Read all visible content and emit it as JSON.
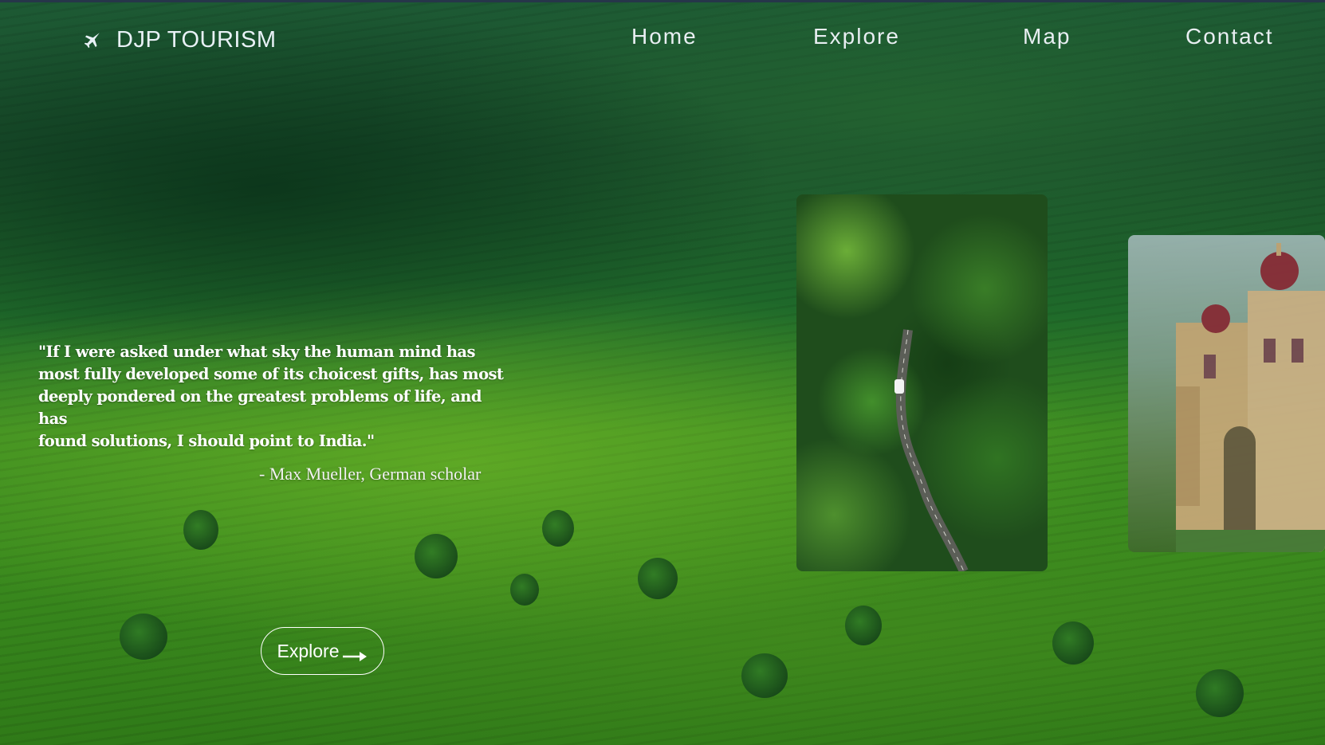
{
  "header": {
    "brand_icon": "airplane-icon",
    "brand_name": "DJP TOURISM"
  },
  "nav": {
    "items": [
      {
        "label": "Home"
      },
      {
        "label": "Explore"
      },
      {
        "label": "Map"
      },
      {
        "label": "Contact"
      }
    ]
  },
  "hero": {
    "quote_lines": [
      "\"If I were asked under what sky the human mind has",
      "most fully developed some of its choicest gifts, has most",
      "deeply pondered on the greatest problems of life, and has",
      "found solutions, I should point to India.\""
    ],
    "author": "- Max Mueller, German scholar",
    "cta_label": "Explore",
    "cta_icon": "arrow-right-icon"
  },
  "gallery": {
    "cards": [
      {
        "name": "forest-road-card"
      },
      {
        "name": "palace-card"
      }
    ]
  },
  "colors": {
    "text": "#ffffff",
    "nav_text": "#e8eef2",
    "background_green": "#2f7a18"
  }
}
